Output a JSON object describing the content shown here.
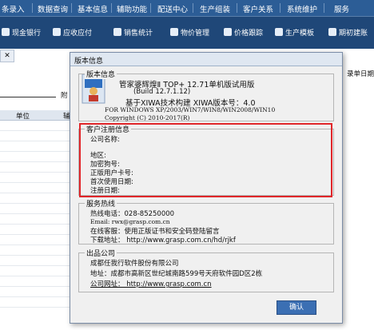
{
  "menubar": {
    "items": [
      "条录入",
      "数据查询",
      "基本信息",
      "辅助功能",
      "配送中心",
      "生产组装",
      "客户关系",
      "系统维护",
      "服务"
    ]
  },
  "toolbar": {
    "items": [
      "现金银行",
      "应收应付",
      "销售统计",
      "物价管理",
      "价格跟踪",
      "生产模板",
      "期初建账"
    ]
  },
  "background": {
    "tab_close": "✕",
    "right_label": "录单日期",
    "field_label": "附",
    "col_unit": "单位",
    "col_aux": "辅"
  },
  "dialog": {
    "title": "版本信息",
    "version_group": {
      "label": "版本信息",
      "line1": "管家婆辉煌Ⅱ TOP+ 12.71单机版试用版",
      "line2": "(Build 12.7.1.12)",
      "line3": "基于XIWA技术构建  XIWA版本号：4.0",
      "line4": "FOR WINDOWS XP/2003/WIN7/WIN8/WIN2008/WIN10",
      "line5": "Copyright (C) 2010-2017(R)"
    },
    "register_group": {
      "label": "客户注册信息",
      "company": "公司名称:",
      "region": "地区:",
      "dog": "加密狗号:",
      "user_card": "正版用户卡号:",
      "first_use": "首次使用日期:",
      "reg_date": "注册日期:"
    },
    "service_group": {
      "label": "服务热线",
      "hotline": "热线电话：028-85250000",
      "email": "Email: rwx@grasp.com.cn",
      "online": "在线客服：使用正版证书和安全码登陆留言",
      "download": "下载地址：  http://www.grasp.com.cn/hd/rjkf"
    },
    "company_group": {
      "label": "出品公司",
      "name": "成都任我行软件股份有限公司",
      "address": "地址：成都市高新区世纪城南路599号天府软件园D区2栋",
      "website": "公司网址： http://www.grasp.com.cn"
    },
    "ok_label": "确认"
  }
}
